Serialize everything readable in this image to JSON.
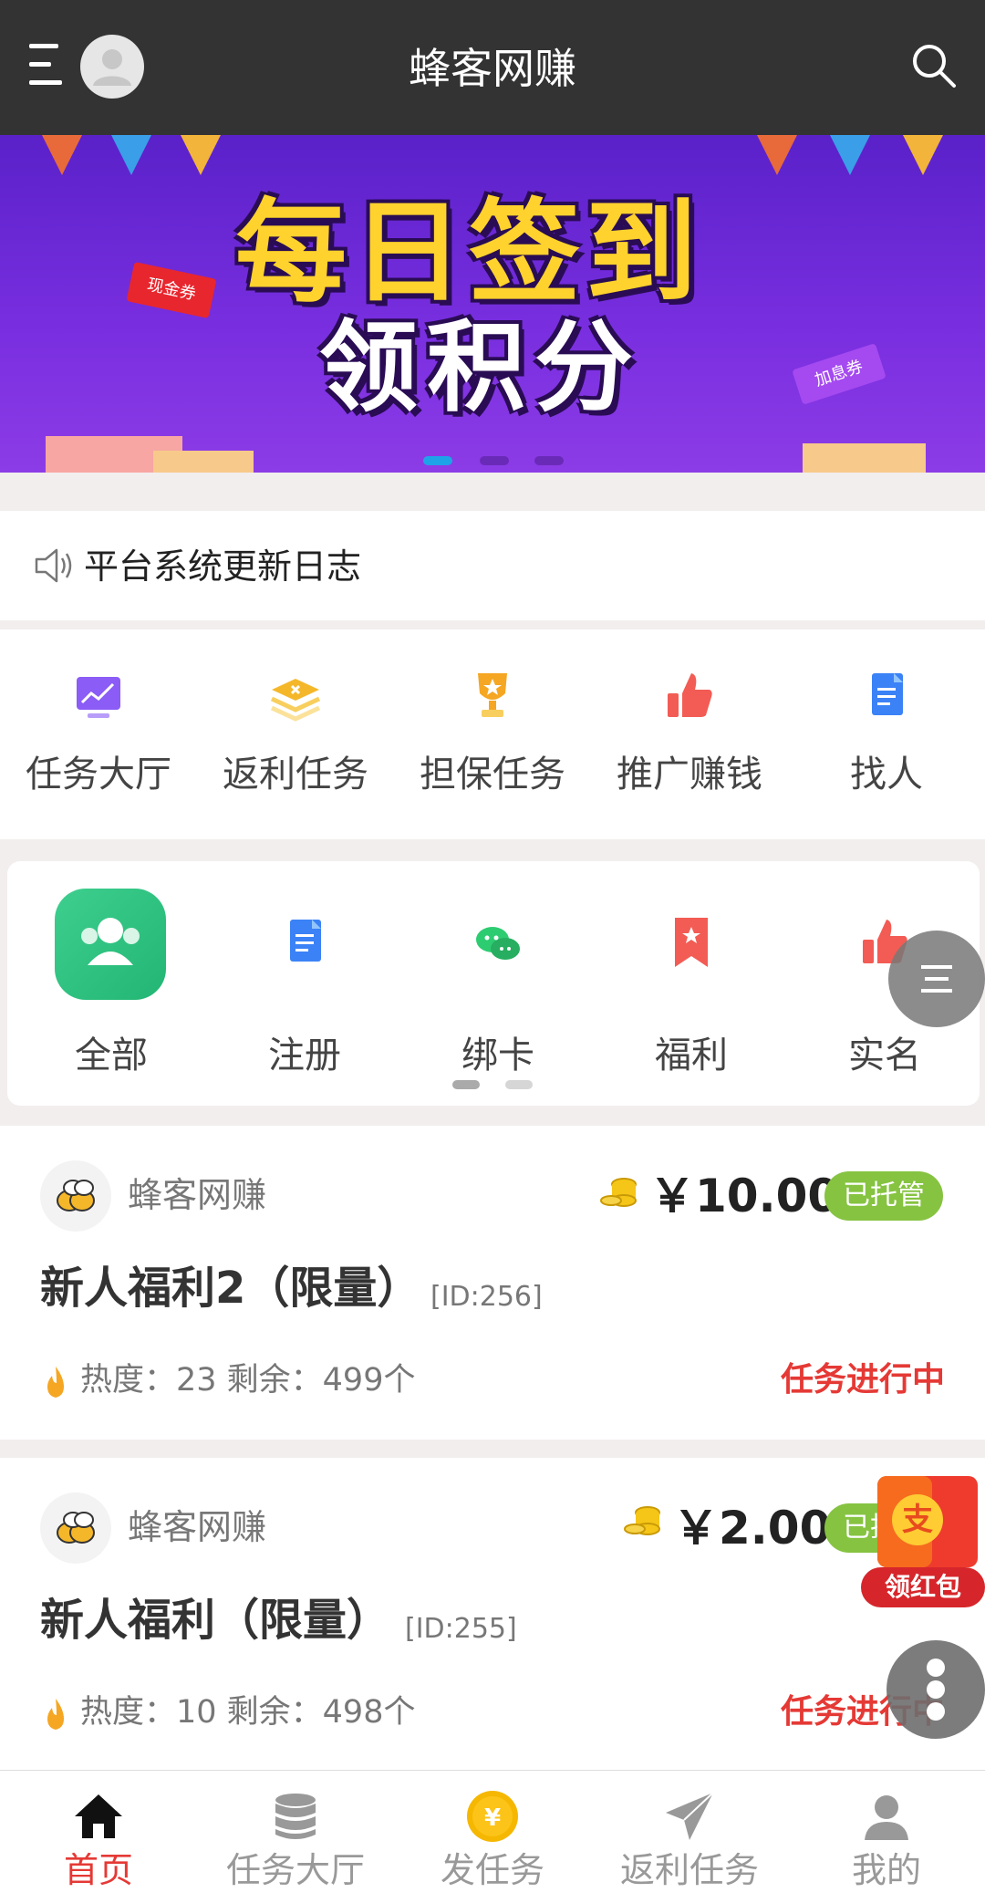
{
  "header": {
    "title": "蜂客网赚"
  },
  "banner": {
    "line1": "每日签到",
    "line2": "领积分",
    "ticket_left": "现金券",
    "ticket_right": "加息券",
    "active_slide": 1,
    "slide_count": 3
  },
  "notice": {
    "text": "平台系统更新日志"
  },
  "quick_grid": [
    {
      "label": "任务大厅",
      "icon": "chart-board-icon"
    },
    {
      "label": "返利任务",
      "icon": "layers-icon"
    },
    {
      "label": "担保任务",
      "icon": "trophy-icon"
    },
    {
      "label": "推广赚钱",
      "icon": "thumbs-up-icon"
    },
    {
      "label": "找人",
      "icon": "document-icon"
    }
  ],
  "category_grid": [
    {
      "label": "全部",
      "icon": "users-icon"
    },
    {
      "label": "注册",
      "icon": "document-icon"
    },
    {
      "label": "绑卡",
      "icon": "wechat-icon"
    },
    {
      "label": "福利",
      "icon": "ribbon-star-icon"
    },
    {
      "label": "实名",
      "icon": "thumbs-up-icon"
    }
  ],
  "tasks": [
    {
      "publisher": "蜂客网赚",
      "price": "￥10.00",
      "badge": "已托管",
      "title": "新人福利2（限量）",
      "id": "[ID:256]",
      "stats": "热度：23  剩余：499个",
      "status": "任务进行中"
    },
    {
      "publisher": "蜂客网赚",
      "price": "￥2.00",
      "badge": "已托管",
      "title": "新人福利（限量）",
      "id": "[ID:255]",
      "stats": "热度：10  剩余：498个",
      "status": "任务进行中"
    }
  ],
  "redpack": {
    "label": "领红包",
    "glyph": "支"
  },
  "bottom_nav": [
    {
      "label": "首页",
      "icon": "home-icon",
      "active": true
    },
    {
      "label": "任务大厅",
      "icon": "database-icon",
      "active": false
    },
    {
      "label": "发任务",
      "icon": "yuan-coin-icon",
      "active": false
    },
    {
      "label": "返利任务",
      "icon": "paper-plane-icon",
      "active": false
    },
    {
      "label": "我的",
      "icon": "user-icon",
      "active": false
    }
  ],
  "colors": {
    "header_bg": "#333333",
    "active_nav": "#e53935",
    "inactive_nav": "#999999",
    "badge_green": "#86c341",
    "status_red": "#e53935"
  }
}
